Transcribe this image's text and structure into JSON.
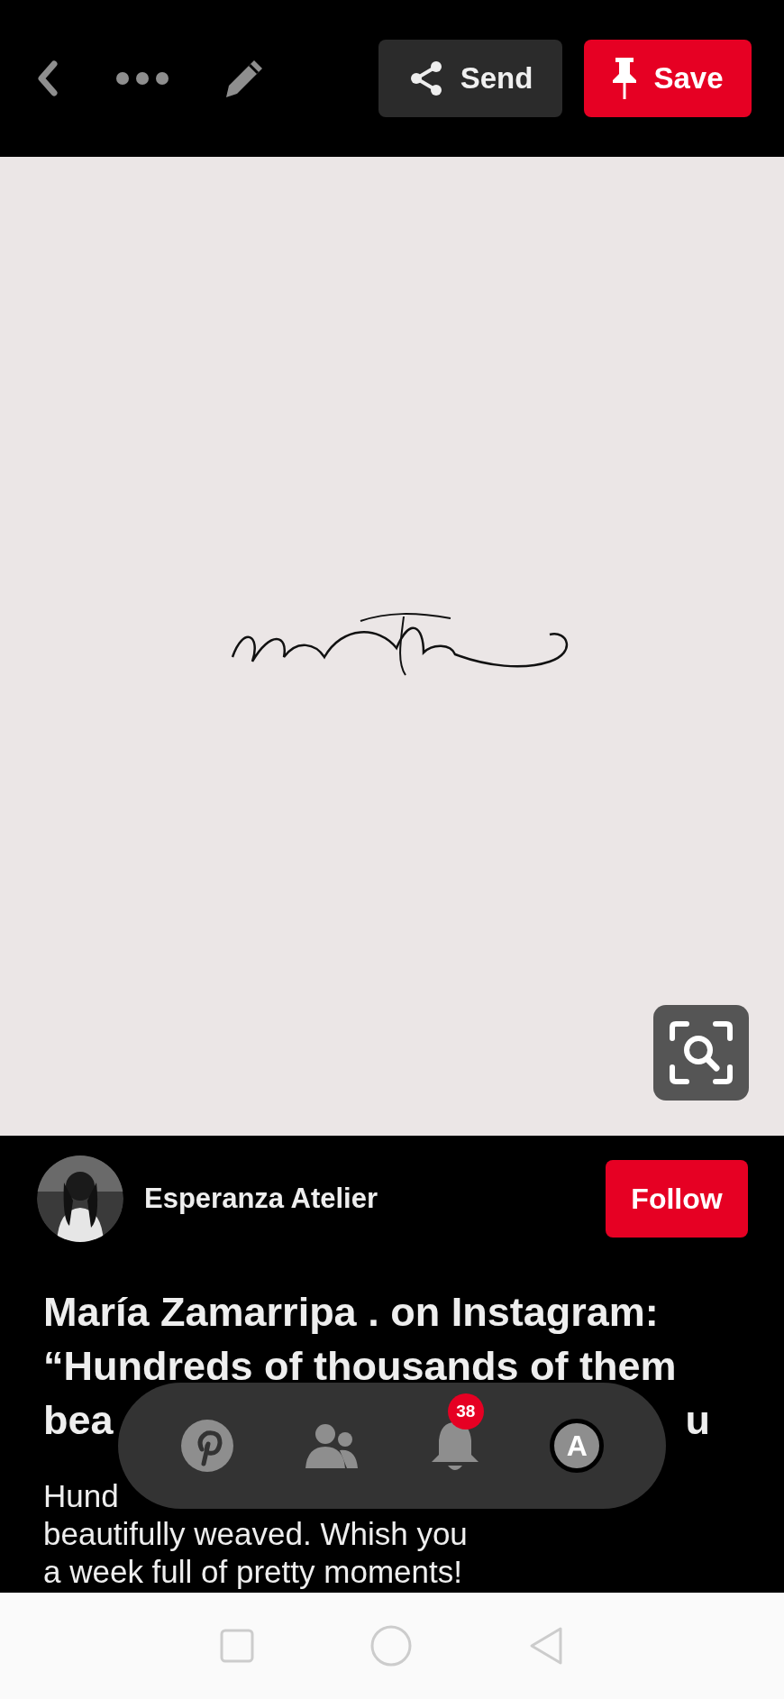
{
  "top_bar": {
    "send_label": "Send",
    "save_label": "Save"
  },
  "creator": {
    "name": "Esperanza Atelier",
    "follow_label": "Follow"
  },
  "title_lines": [
    "María Zamarripa . on Instagram:",
    "“Hundreds of thousands of them"
  ],
  "title_fragments": [
    "bea",
    "u"
  ],
  "description_fragment": "Hund",
  "description_lines": [
    "beautifully weaved.  Whish you",
    "a week full of pretty moments!"
  ],
  "bottom_nav": {
    "notification_count": "38",
    "avatar_letter": "A"
  }
}
